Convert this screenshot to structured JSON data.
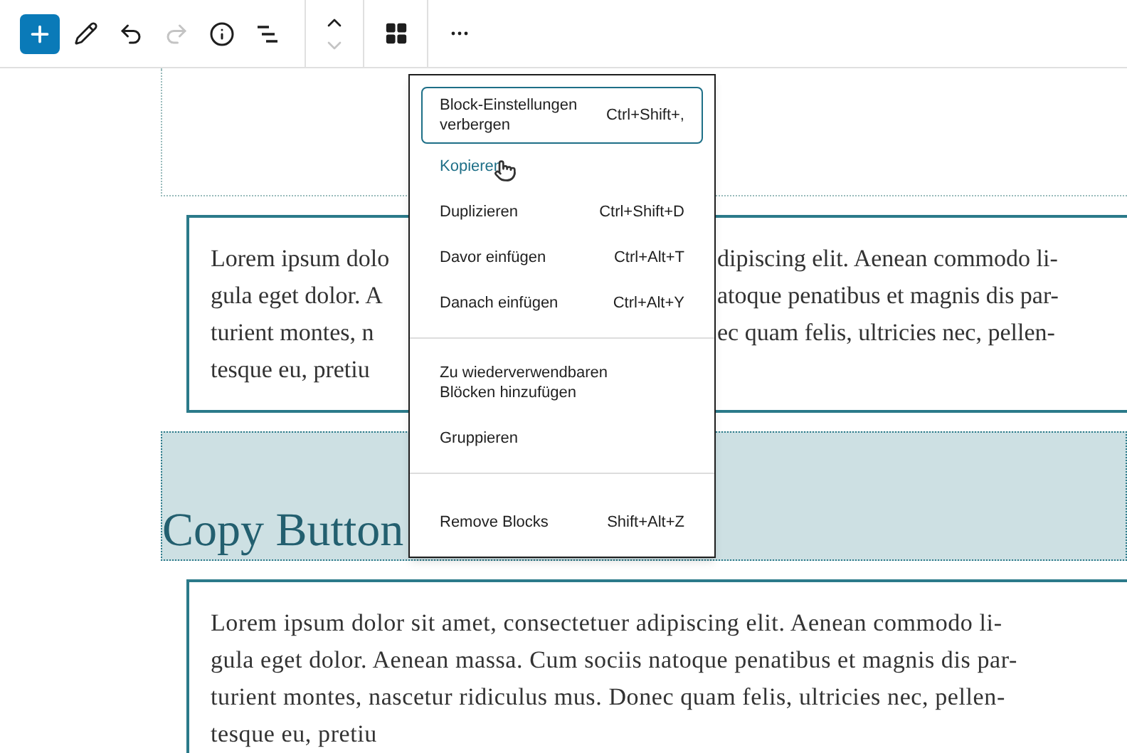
{
  "toolbar": {
    "groups": [
      [
        {
          "kind": "add",
          "disabled": false,
          "selected": true
        },
        {
          "kind": "edit",
          "disabled": false,
          "selected": false
        },
        {
          "kind": "undo",
          "disabled": false,
          "selected": false
        },
        {
          "kind": "redo",
          "disabled": true,
          "selected": false
        },
        {
          "kind": "info",
          "disabled": false,
          "selected": false
        },
        {
          "kind": "outline",
          "disabled": false,
          "selected": false
        }
      ],
      [
        {
          "kind": "move-up",
          "disabled": false,
          "selected": false
        },
        {
          "kind": "move-down",
          "disabled": true,
          "selected": false
        }
      ],
      [
        {
          "kind": "block",
          "disabled": false,
          "selected": false
        }
      ],
      [
        {
          "kind": "more",
          "disabled": false,
          "selected": false
        }
      ]
    ]
  },
  "paragraph_1": {
    "selected": false,
    "lines": [
      {
        "left": "Lorem ipsum dolo",
        "right": "dipiscing elit. Aenean commodo li-"
      },
      {
        "left": "gula eget dolor. A",
        "right": "atoque penatibus et magnis dis par-"
      },
      {
        "left": "turient montes, n",
        "right": "ec quam felis, ultricies nec, pellen-"
      },
      {
        "left": "tesque eu, pretiu"
      }
    ]
  },
  "heading": {
    "text": "Copy Button",
    "selected": true
  },
  "paragraph_2": {
    "selected": false,
    "lines": [
      "Lorem ipsum dolor sit amet, consectetuer adipiscing elit. Aenean commodo li-",
      "gula eget dolor. Aenean massa. Cum sociis natoque penatibus et magnis dis par-",
      "turient montes, nascetur ridiculus mus. Donec quam felis, ultricies nec, pellen-",
      "tesque eu, pretiu"
    ]
  },
  "menu": {
    "sections": [
      [
        {
          "label": "Block-Einstellungen verbergen",
          "shortcut": "Ctrl+Shift+,",
          "focused": true,
          "hovered": false
        },
        {
          "label": "Kopieren",
          "focused": false,
          "hovered": true
        },
        {
          "label": "Duplizieren",
          "shortcut": "Ctrl+Shift+D",
          "focused": false,
          "hovered": false
        },
        {
          "label": "Davor einfügen",
          "shortcut": "Ctrl+Alt+T",
          "focused": false,
          "hovered": false
        },
        {
          "label": "Danach einfügen",
          "shortcut": "Ctrl+Alt+Y",
          "focused": false,
          "hovered": false
        }
      ],
      [
        {
          "label": "Zu wiederverwendbaren Blöcken hinzufügen",
          "focused": false,
          "hovered": false
        },
        {
          "label": "Gruppieren",
          "focused": false,
          "hovered": false
        }
      ],
      [
        {
          "label": "Remove Blocks",
          "shortcut": "Shift+Alt+Z",
          "focused": false,
          "hovered": false
        }
      ]
    ]
  }
}
